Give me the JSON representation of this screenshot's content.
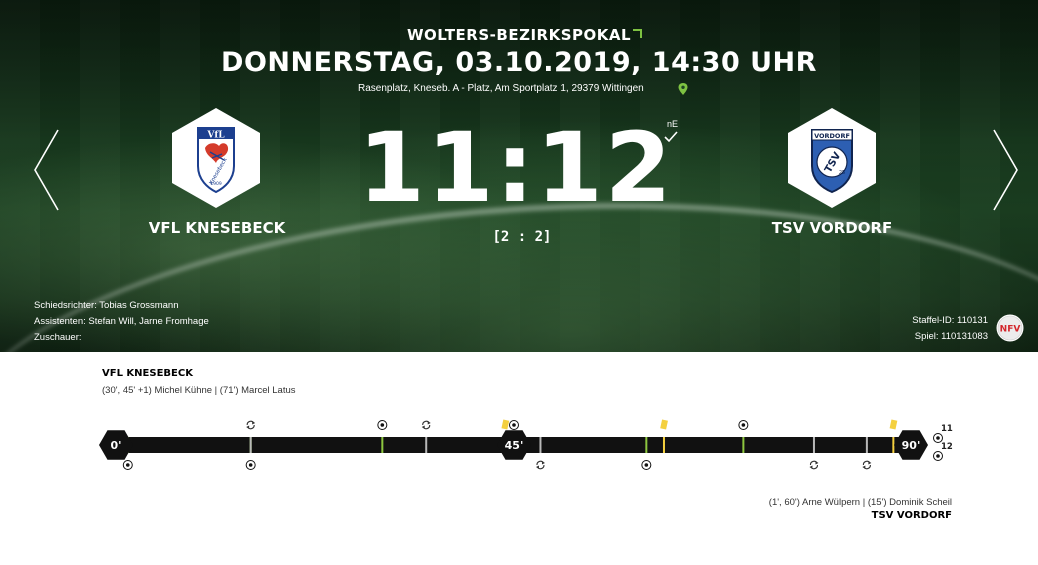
{
  "header": {
    "competition": "WOLTERS-BEZIRKSPOKAL",
    "datetime": "DONNERSTAG, 03.10.2019, 14:30 UHR",
    "venue": "Rasenplatz, Kneseb. A - Platz, Am Sportplatz 1, 29379 Wittingen"
  },
  "match": {
    "home_team": "VFL KNESEBECK",
    "away_team": "TSV VORDORF",
    "score": "11:12",
    "result_type": "nE",
    "halftime": "[2 : 2]",
    "home_logo_text": "VfL",
    "home_logo_sub": "Knesebeck",
    "home_logo_year": "1909",
    "away_logo_top": "VORDORF",
    "away_logo_main": "TSV",
    "away_logo_sub": "25"
  },
  "officials": {
    "referee": "Schiedsrichter: Tobias Grossmann",
    "assistants": "Assistenten: Stefan Will, Jarne Fromhage",
    "spectators": "Zuschauer:"
  },
  "ids": {
    "staffel": "Staffel-ID: 110131",
    "spiel": "Spiel: 110131083",
    "association_logo": "NFV"
  },
  "timeline": {
    "home_label": "VFL KNESEBECK",
    "home_scorers": "(30', 45' +1) Michel Kühne | (71') Marcel Latus",
    "away_scorers": "(1', 60') Arne Wülpern | (15') Dominik Scheil",
    "away_label": "TSV VORDORF",
    "marker_start": "0'",
    "marker_half": "45'",
    "marker_end": "90'",
    "penalties_home": "11",
    "penalties_away": "12",
    "colors": {
      "bar": "#111111",
      "tick_green": "#8dc63f",
      "tick_yellow": "#f4d03f",
      "tick_grey": "#b9b9b9"
    },
    "events": [
      {
        "minute": 1,
        "team": "away",
        "type": "goal"
      },
      {
        "minute": 15,
        "team": "away",
        "type": "goal"
      },
      {
        "minute": 15,
        "team": "home",
        "type": "substitution"
      },
      {
        "minute": 30,
        "team": "home",
        "type": "goal"
      },
      {
        "minute": 35,
        "team": "home",
        "type": "substitution"
      },
      {
        "minute": 44,
        "team": "home",
        "type": "yellow-card"
      },
      {
        "minute": 45,
        "team": "home",
        "type": "goal"
      },
      {
        "minute": 48,
        "team": "away",
        "type": "substitution"
      },
      {
        "minute": 60,
        "team": "away",
        "type": "goal"
      },
      {
        "minute": 62,
        "team": "home",
        "type": "yellow-card"
      },
      {
        "minute": 71,
        "team": "home",
        "type": "goal"
      },
      {
        "minute": 79,
        "team": "away",
        "type": "substitution"
      },
      {
        "minute": 85,
        "team": "away",
        "type": "substitution"
      },
      {
        "minute": 88,
        "team": "home",
        "type": "yellow-card"
      }
    ]
  }
}
